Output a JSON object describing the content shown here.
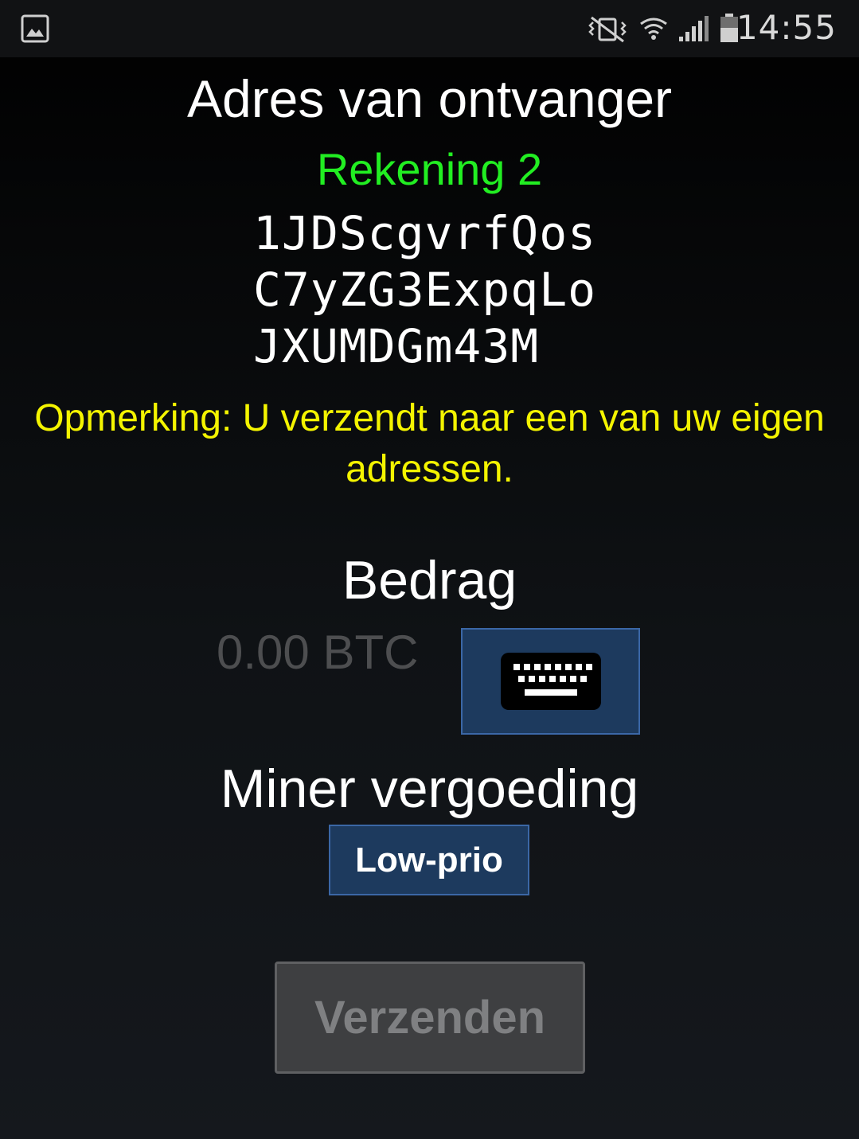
{
  "status_bar": {
    "time": "14:55",
    "icons": [
      "gallery-icon",
      "vibrate-mute-icon",
      "wifi-icon",
      "signal-icon",
      "battery-icon"
    ]
  },
  "recipient": {
    "title": "Adres van ontvanger",
    "account_label": "Rekening 2",
    "address_lines": [
      "1JDScgvrfQos",
      "C7yZG3ExpqLo",
      "JXUMDGm43M"
    ],
    "note": "Opmerking: U verzendt naar een van uw eigen adressen."
  },
  "amount": {
    "title": "Bedrag",
    "placeholder": "0.00 BTC",
    "keyboard_icon": "keyboard-icon"
  },
  "fee": {
    "title": "Miner vergoeding",
    "button_label": "Low-prio"
  },
  "send": {
    "label": "Verzenden",
    "enabled": false
  },
  "colors": {
    "account_label": "#22ee22",
    "note": "#f4f400",
    "button_bg": "#1d3a5e",
    "button_border": "#3b67a6",
    "disabled_button_bg": "#3e3f41"
  }
}
